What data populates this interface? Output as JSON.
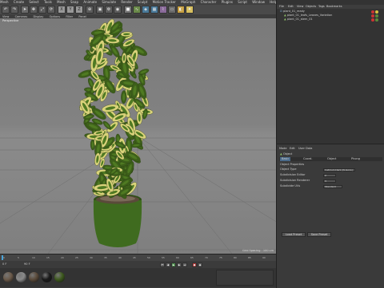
{
  "menubar": {
    "items": [
      "Mesh",
      "Create",
      "Select",
      "Tools",
      "Mesh",
      "Snap",
      "Animate",
      "Simulate",
      "Render",
      "Sculpt",
      "Motion Tracker",
      "MoGraph",
      "Character",
      "Plugins",
      "Script",
      "Window",
      "Help"
    ]
  },
  "viewport": {
    "menu": [
      "View",
      "Cameras",
      "Display",
      "Options",
      "Filter",
      "Panel"
    ],
    "label": "Perspective",
    "status": "Grid Spacing : 100 cm"
  },
  "timeline": {
    "ticks": [
      "0",
      "5",
      "10",
      "15",
      "20",
      "25",
      "30",
      "35",
      "40",
      "45",
      "50",
      "55",
      "60",
      "65",
      "70",
      "75",
      "80",
      "85",
      "90"
    ],
    "start_frame": "0 F",
    "end_frame": "90 F"
  },
  "object_manager": {
    "menu": [
      "File",
      "Edit",
      "View",
      "Objects",
      "Tags",
      "Bookmarks"
    ],
    "objects": [
      "plant_01_ready",
      "plant_01_leafs_Leaves_Variation",
      "plant_01_stem_01"
    ]
  },
  "attribute_manager": {
    "menu": [
      "Mode",
      "Edit",
      "User Data"
    ],
    "object_label": "Object",
    "tabs": [
      "Basic",
      "Coord.",
      "Object",
      "Phong"
    ],
    "section": "Object Properties",
    "fields": [
      {
        "label": "Object Type",
        "value": "Catmull-Clark (N-Gons)"
      },
      {
        "label": "Subdivision Editor",
        "value": "2"
      },
      {
        "label": "Subdivision Renderer",
        "value": "3"
      },
      {
        "label": "Subdivide UVs",
        "value": "Standard"
      }
    ],
    "buttons": [
      "Load Preset",
      "Save Preset"
    ]
  },
  "materials": {
    "menu": [
      "Create",
      "Edit",
      "Function",
      "Texture"
    ],
    "colors": [
      "#6b5a4a",
      "#8a8a8a",
      "#5a4a3a",
      "#1b1b1b",
      "#3e5a1e"
    ]
  },
  "colors": {
    "pot": "#3f6b1f",
    "leaf_dark": "#3d5f1a",
    "leaf_light": "#d9d27a"
  }
}
